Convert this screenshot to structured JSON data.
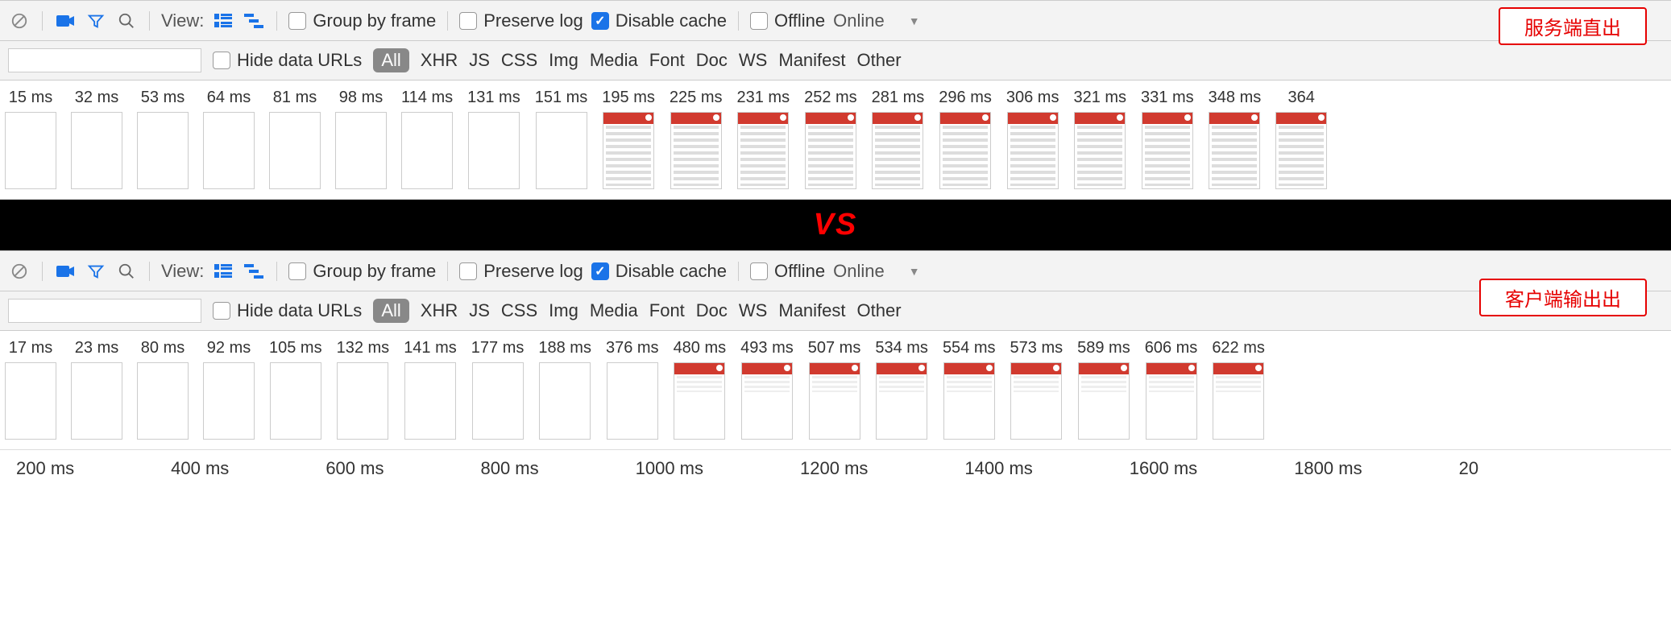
{
  "vs_label": "VS",
  "toolbar": {
    "view_label": "View:",
    "group_by_frame": "Group by frame",
    "preserve_log": "Preserve log",
    "disable_cache": "Disable cache",
    "offline": "Offline",
    "online_label": "Online"
  },
  "filters": {
    "hide_data_urls": "Hide data URLs",
    "all": "All",
    "items": [
      "XHR",
      "JS",
      "CSS",
      "Img",
      "Media",
      "Font",
      "Doc",
      "WS",
      "Manifest",
      "Other"
    ]
  },
  "top": {
    "badge": "服务端直出",
    "frames": [
      {
        "t": "15 ms",
        "state": "blank"
      },
      {
        "t": "32 ms",
        "state": "blank"
      },
      {
        "t": "53 ms",
        "state": "blank"
      },
      {
        "t": "64 ms",
        "state": "blank"
      },
      {
        "t": "81 ms",
        "state": "blank"
      },
      {
        "t": "98 ms",
        "state": "blank"
      },
      {
        "t": "114 ms",
        "state": "blank"
      },
      {
        "t": "131 ms",
        "state": "blank"
      },
      {
        "t": "151 ms",
        "state": "blank"
      },
      {
        "t": "195 ms",
        "state": "full"
      },
      {
        "t": "225 ms",
        "state": "full"
      },
      {
        "t": "231 ms",
        "state": "full"
      },
      {
        "t": "252 ms",
        "state": "full"
      },
      {
        "t": "281 ms",
        "state": "full"
      },
      {
        "t": "296 ms",
        "state": "full"
      },
      {
        "t": "306 ms",
        "state": "full"
      },
      {
        "t": "321 ms",
        "state": "full"
      },
      {
        "t": "331 ms",
        "state": "full"
      },
      {
        "t": "348 ms",
        "state": "full"
      },
      {
        "t": "364",
        "state": "full"
      }
    ]
  },
  "bottom": {
    "badge": "客户端输出出",
    "frames": [
      {
        "t": "17 ms",
        "state": "blank"
      },
      {
        "t": "23 ms",
        "state": "blank"
      },
      {
        "t": "80 ms",
        "state": "blank"
      },
      {
        "t": "92 ms",
        "state": "blank"
      },
      {
        "t": "105 ms",
        "state": "blank"
      },
      {
        "t": "132 ms",
        "state": "blank"
      },
      {
        "t": "141 ms",
        "state": "blank"
      },
      {
        "t": "177 ms",
        "state": "blank"
      },
      {
        "t": "188 ms",
        "state": "blank"
      },
      {
        "t": "376 ms",
        "state": "blank"
      },
      {
        "t": "480 ms",
        "state": "partial"
      },
      {
        "t": "493 ms",
        "state": "partial"
      },
      {
        "t": "507 ms",
        "state": "partial"
      },
      {
        "t": "534 ms",
        "state": "partial"
      },
      {
        "t": "554 ms",
        "state": "partial"
      },
      {
        "t": "573 ms",
        "state": "partial"
      },
      {
        "t": "589 ms",
        "state": "partial"
      },
      {
        "t": "606 ms",
        "state": "partial"
      },
      {
        "t": "622 ms",
        "state": "partial"
      }
    ],
    "ruler": [
      "200 ms",
      "400 ms",
      "600 ms",
      "800 ms",
      "1000 ms",
      "1200 ms",
      "1400 ms",
      "1600 ms",
      "1800 ms",
      "20"
    ]
  }
}
